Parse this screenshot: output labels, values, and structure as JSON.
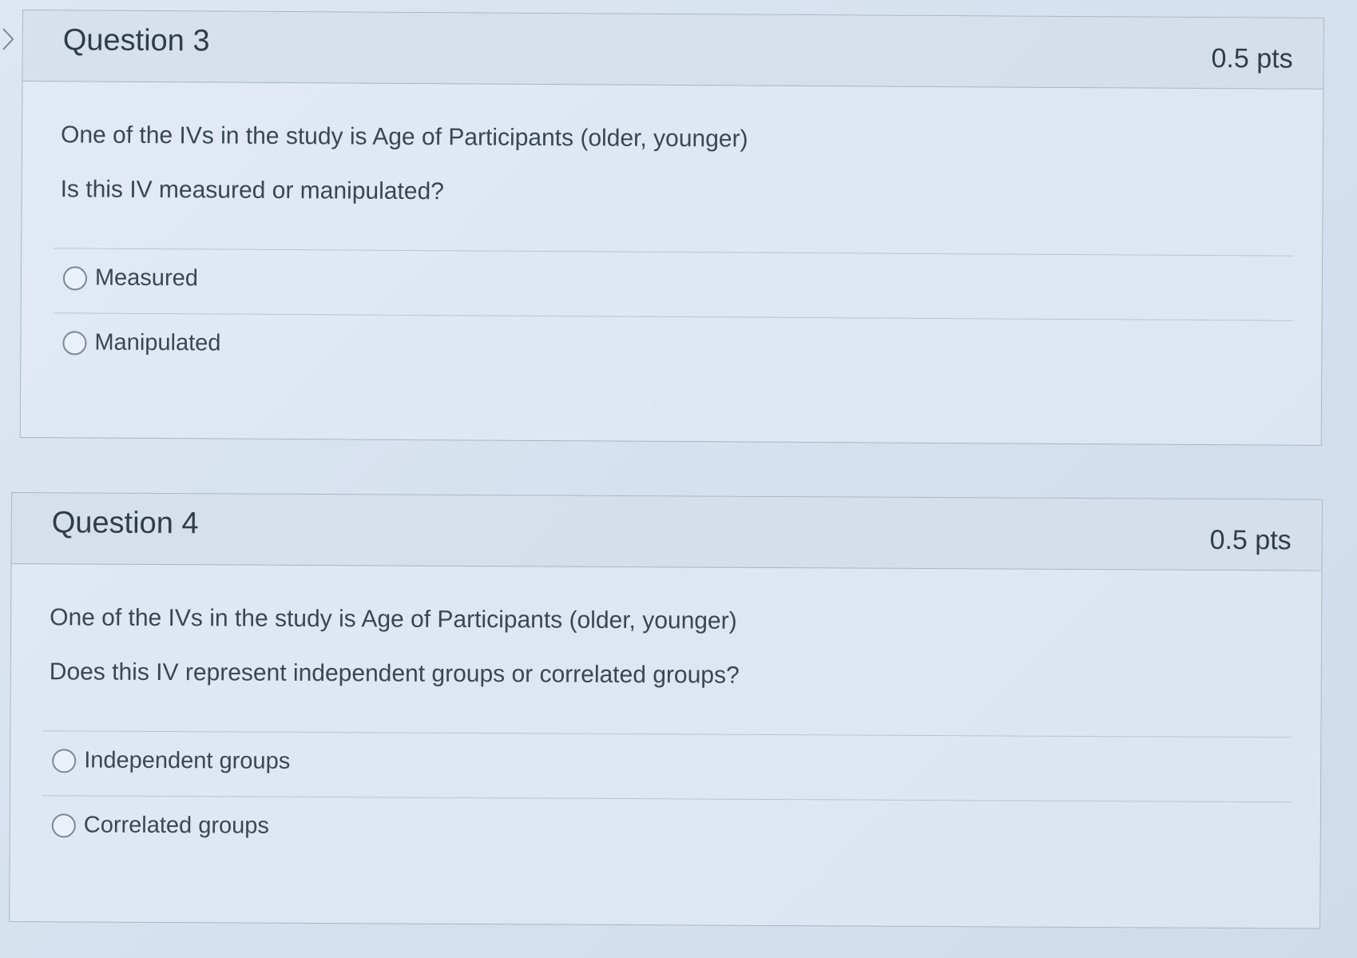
{
  "questions": [
    {
      "title": "Question 3",
      "points": "0.5 pts",
      "prompt_line1": "One of the IVs in the study is Age of Participants (older, younger)",
      "prompt_line2": "Is this IV measured or manipulated?",
      "answers": [
        "Measured",
        "Manipulated"
      ]
    },
    {
      "title": "Question 4",
      "points": "0.5 pts",
      "prompt_line1": "One of the IVs in the study is Age of Participants (older, younger)",
      "prompt_line2": "Does this IV represent independent groups or correlated groups?",
      "answers": [
        "Independent groups",
        "Correlated groups"
      ]
    }
  ],
  "icons": {
    "nav": "chevron-right-icon",
    "radio": "radio-unselected-icon"
  },
  "colors": {
    "text": "#2d3b45",
    "border": "#a9b6c3",
    "header_bg": "#cdd8e5"
  }
}
